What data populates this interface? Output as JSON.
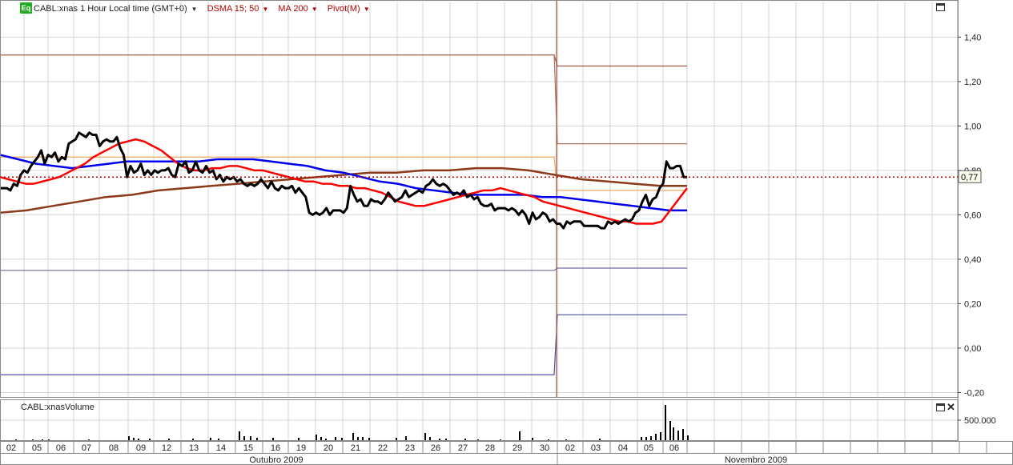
{
  "header": {
    "eq_badge": "Eq",
    "symbol_title": "CABL:xnas 1 Hour Local time (GMT+0)",
    "studies": [
      "DSMA 15; 50",
      "MA 200",
      "Pivot(M)"
    ]
  },
  "volume_panel": {
    "label": "CABL:xnasVolume",
    "tick": "500.000"
  },
  "last_price_label": "0,77",
  "colors": {
    "price": "#000000",
    "dsma15": "#ff0000",
    "dsma50": "#0000ee",
    "ma200": "#8b3a1a",
    "pivot_r2": "#9a5a48",
    "pivot_r1": "#b07060",
    "pivot_p": "#f0a860",
    "pivot_s1": "#6a6aa0",
    "pivot_s2": "#5050a0",
    "last_line": "#c00000",
    "grid": "#d4d4d4"
  },
  "chart_data": {
    "type": "line",
    "title": "CABL:xnas 1 Hour Local time (GMT+0)",
    "xlabel": "",
    "ylabel": "",
    "ylim": [
      -0.22,
      1.56
    ],
    "y_ticks": [
      "1,40",
      "1,20",
      "1,00",
      "0,80",
      "0,60",
      "0,40",
      "0,20",
      "0,00",
      "-0,20"
    ],
    "y_tick_values": [
      1.4,
      1.2,
      1.0,
      0.8,
      0.6,
      0.4,
      0.2,
      0.0,
      -0.2
    ],
    "grid": true,
    "last_price": 0.77,
    "x_days": [
      "02",
      "05",
      "06",
      "07",
      "08",
      "09",
      "12",
      "13",
      "14",
      "15",
      "16",
      "19",
      "20",
      "21",
      "22",
      "23",
      "26",
      "27",
      "28",
      "29",
      "30",
      "02",
      "03",
      "04",
      "05",
      "06"
    ],
    "months": [
      {
        "label": "Outubro 2009",
        "start": 0,
        "end": 20
      },
      {
        "label": "Novembro 2009",
        "start": 21,
        "end": 25
      }
    ],
    "series": [
      {
        "name": "CABL:xnas",
        "values": [
          0.72,
          0.72,
          0.72,
          0.71,
          0.74,
          0.73,
          0.78,
          0.8,
          0.79,
          0.82,
          0.84,
          0.86,
          0.89,
          0.83,
          0.87,
          0.86,
          0.88,
          0.84,
          0.86,
          0.85,
          0.92,
          0.93,
          0.94,
          0.97,
          0.96,
          0.95,
          0.97,
          0.96,
          0.96,
          0.91,
          0.93,
          0.94,
          0.93,
          0.93,
          0.95,
          0.9,
          0.87,
          0.77,
          0.82,
          0.79,
          0.8,
          0.83,
          0.78,
          0.8,
          0.78,
          0.8,
          0.79,
          0.8,
          0.8,
          0.81,
          0.78,
          0.77,
          0.83,
          0.82,
          0.84,
          0.79,
          0.8,
          0.84,
          0.8,
          0.79,
          0.82,
          0.79,
          0.8,
          0.76,
          0.78,
          0.75,
          0.77,
          0.76,
          0.77,
          0.75,
          0.76,
          0.74,
          0.73,
          0.74,
          0.73,
          0.74,
          0.76,
          0.74,
          0.72,
          0.75,
          0.72,
          0.71,
          0.73,
          0.72,
          0.72,
          0.73,
          0.7,
          0.72,
          0.7,
          0.68,
          0.61,
          0.6,
          0.61,
          0.6,
          0.61,
          0.63,
          0.6,
          0.62,
          0.62,
          0.62,
          0.61,
          0.63,
          0.73,
          0.69,
          0.66,
          0.67,
          0.64,
          0.64,
          0.67,
          0.66,
          0.66,
          0.65,
          0.67,
          0.7,
          0.68,
          0.66,
          0.67,
          0.68,
          0.71,
          0.68,
          0.69,
          0.7,
          0.71,
          0.7,
          0.73,
          0.74,
          0.76,
          0.74,
          0.73,
          0.74,
          0.73,
          0.71,
          0.69,
          0.7,
          0.69,
          0.71,
          0.68,
          0.69,
          0.67,
          0.68,
          0.65,
          0.64,
          0.64,
          0.65,
          0.62,
          0.63,
          0.63,
          0.63,
          0.62,
          0.63,
          0.62,
          0.6,
          0.62,
          0.6,
          0.56,
          0.61,
          0.58,
          0.59,
          0.61,
          0.6,
          0.57,
          0.58,
          0.56,
          0.56,
          0.54,
          0.57,
          0.56,
          0.57,
          0.57,
          0.57,
          0.55,
          0.55,
          0.55,
          0.55,
          0.55,
          0.54,
          0.54,
          0.57,
          0.56,
          0.57,
          0.56,
          0.57,
          0.58,
          0.57,
          0.58,
          0.61,
          0.62,
          0.66,
          0.69,
          0.64,
          0.67,
          0.68,
          0.72,
          0.74,
          0.84,
          0.81,
          0.81,
          0.82,
          0.82,
          0.77,
          0.77
        ]
      },
      {
        "name": "DSMA 15",
        "values": [
          0.77,
          0.76,
          0.75,
          0.74,
          0.74,
          0.75,
          0.76,
          0.77,
          0.79,
          0.81,
          0.83,
          0.86,
          0.88,
          0.9,
          0.92,
          0.93,
          0.94,
          0.93,
          0.91,
          0.89,
          0.86,
          0.83,
          0.81,
          0.8,
          0.8,
          0.81,
          0.81,
          0.82,
          0.82,
          0.81,
          0.8,
          0.8,
          0.79,
          0.78,
          0.77,
          0.76,
          0.75,
          0.75,
          0.74,
          0.74,
          0.73,
          0.73,
          0.72,
          0.72,
          0.71,
          0.7,
          0.68,
          0.66,
          0.65,
          0.64,
          0.64,
          0.65,
          0.66,
          0.67,
          0.68,
          0.69,
          0.7,
          0.71,
          0.71,
          0.72,
          0.71,
          0.7,
          0.69,
          0.68,
          0.66,
          0.65,
          0.64,
          0.63,
          0.62,
          0.61,
          0.6,
          0.59,
          0.58,
          0.57,
          0.57,
          0.56,
          0.56,
          0.56,
          0.57,
          0.62,
          0.67,
          0.72
        ]
      },
      {
        "name": "DSMA 50",
        "values": [
          0.87,
          0.85,
          0.83,
          0.82,
          0.81,
          0.82,
          0.83,
          0.84,
          0.84,
          0.84,
          0.84,
          0.84,
          0.85,
          0.85,
          0.85,
          0.84,
          0.83,
          0.82,
          0.8,
          0.79,
          0.77,
          0.75,
          0.74,
          0.72,
          0.71,
          0.7,
          0.69,
          0.69,
          0.69,
          0.69,
          0.68,
          0.68,
          0.67,
          0.66,
          0.65,
          0.64,
          0.63,
          0.62,
          0.62
        ]
      },
      {
        "name": "MA 200",
        "values": [
          0.61,
          0.62,
          0.64,
          0.66,
          0.68,
          0.69,
          0.71,
          0.72,
          0.73,
          0.74,
          0.75,
          0.76,
          0.77,
          0.78,
          0.79,
          0.79,
          0.8,
          0.8,
          0.81,
          0.81,
          0.8,
          0.78,
          0.76,
          0.75,
          0.74,
          0.73,
          0.73
        ]
      }
    ],
    "pivot_levels": {
      "oct": {
        "R2": 1.32,
        "R1": 1.32,
        "P": 0.86,
        "S1": 0.35,
        "S2": -0.12
      },
      "nov": {
        "R2": 1.27,
        "R1": 0.92,
        "P": 0.71,
        "S1": 0.36,
        "S2": 0.15
      }
    },
    "volume": [
      0,
      0,
      0,
      0,
      0,
      0,
      0,
      0,
      0,
      0,
      0,
      0,
      0,
      0,
      0,
      0,
      0,
      0,
      0,
      0,
      0,
      0,
      0,
      0,
      0,
      0,
      0,
      0,
      0,
      0,
      0,
      0,
      0,
      0,
      0,
      40,
      0,
      0,
      0,
      0,
      0,
      0,
      0,
      0,
      0,
      0,
      0,
      0,
      0,
      0,
      0,
      0,
      0,
      0,
      0,
      0,
      0,
      0,
      0,
      0,
      0,
      0,
      0,
      0,
      0,
      0,
      0,
      0,
      0,
      0,
      0,
      0,
      0,
      0,
      0,
      0,
      0,
      0,
      0,
      0,
      0,
      0,
      0,
      0,
      0,
      0,
      0,
      0,
      0,
      0,
      0,
      0,
      0,
      0,
      0,
      0,
      0,
      0,
      0,
      0,
      0,
      0,
      0,
      0,
      0,
      0,
      0,
      0,
      0,
      0,
      0,
      0,
      0,
      0,
      0,
      0,
      0,
      0,
      0,
      0,
      0,
      0,
      0,
      0,
      0,
      0,
      0,
      0,
      0,
      0,
      0,
      0,
      0,
      0,
      0,
      0,
      0,
      0,
      0,
      0,
      0,
      0,
      0,
      0,
      0,
      0,
      0,
      0,
      0,
      0,
      0,
      0,
      0,
      0,
      0,
      0,
      0,
      0,
      0,
      0,
      0,
      0,
      0,
      0,
      0,
      0,
      0,
      0,
      0,
      0,
      0,
      0,
      0,
      0,
      0,
      0,
      0,
      0,
      0,
      0,
      0,
      0,
      0,
      0,
      0,
      0,
      0,
      0,
      0,
      0,
      0,
      0,
      0,
      0,
      0,
      0,
      0,
      0,
      0,
      0,
      0,
      0,
      0,
      0
    ]
  }
}
